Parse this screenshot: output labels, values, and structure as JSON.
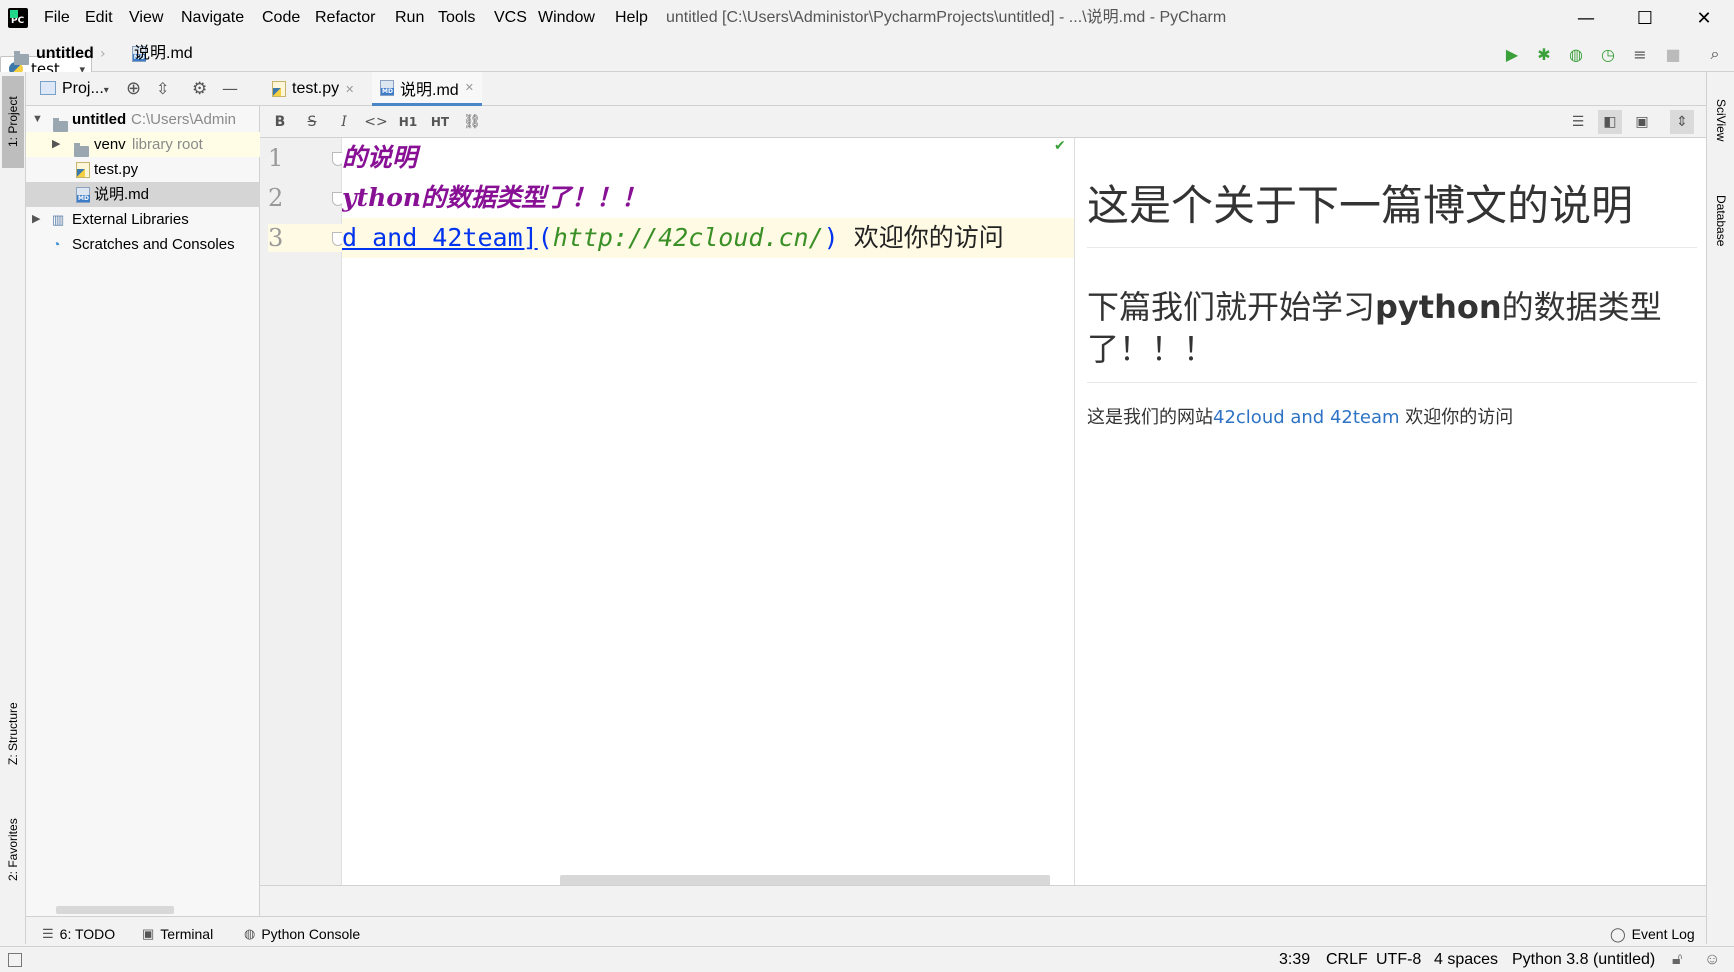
{
  "title_bar": {
    "menu": [
      "File",
      "Edit",
      "View",
      "Navigate",
      "Code",
      "Refactor",
      "Run",
      "Tools",
      "VCS",
      "Window",
      "Help"
    ],
    "window_title": "untitled [C:\\Users\\Administor\\PycharmProjects\\untitled] - ...\\说明.md - PyCharm",
    "controls": {
      "minimize": "—",
      "maximize": "☐",
      "close": "✕"
    }
  },
  "breadcrumb": {
    "project": "untitled",
    "file": "说明.md"
  },
  "run_config": {
    "name": "test"
  },
  "left_stripe": {
    "project": "1: Project",
    "structure": "Z: Structure",
    "favorites": "2: Favorites"
  },
  "right_stripe": {
    "sciview": "SciView",
    "database": "Database"
  },
  "project_panel": {
    "header": "Proj...",
    "tree": [
      {
        "label": "untitled",
        "hint": "C:\\Users\\Admin"
      },
      {
        "label": "venv",
        "hint": "library root"
      },
      {
        "label": "test.py",
        "hint": ""
      },
      {
        "label": "说明.md",
        "hint": ""
      },
      {
        "label": "External Libraries",
        "hint": ""
      },
      {
        "label": "Scratches and Consoles",
        "hint": ""
      }
    ]
  },
  "tabs": [
    {
      "label": "test.py",
      "active": false
    },
    {
      "label": "说明.md",
      "active": true
    }
  ],
  "md_toolbar": {
    "bold": "B",
    "strike": "S",
    "italic": "I",
    "code": "<>",
    "h1": "H1",
    "ht": "HT"
  },
  "editor": {
    "line_numbers": [
      "1",
      "2",
      "3"
    ],
    "lines": [
      {
        "text": "的说明"
      },
      {
        "text": "ython的数据类型了！！！"
      },
      {
        "link": "d and 42team]",
        "paren_open": "(",
        "url": "http://42cloud.cn/",
        "paren_close": ")",
        "rest": " 欢迎你的访问"
      }
    ]
  },
  "preview": {
    "h1": "这是个关于下一篇博文的说明",
    "h2_pre": "下篇我们就开始学习",
    "h2_bold": "python",
    "h2_post": "的数据类型了！！！",
    "para_pre": "这是我们的网站",
    "para_link": "42cloud and 42team",
    "para_post": " 欢迎你的访问"
  },
  "bottom_tools": {
    "todo": "6: TODO",
    "terminal": "Terminal",
    "console": "Python Console",
    "event_log": "Event Log"
  },
  "status": {
    "position": "3:39",
    "line_sep": "CRLF",
    "encoding": "UTF-8",
    "indent": "4 spaces",
    "interpreter": "Python 3.8 (untitled)"
  },
  "colors": {
    "md_heading": "#871094",
    "md_link": "#0033ee",
    "md_url": "#3a8f26",
    "preview_link": "#2e73c4",
    "line_highlight": "#fffae3",
    "tree_selected": "#d5d5d5"
  }
}
